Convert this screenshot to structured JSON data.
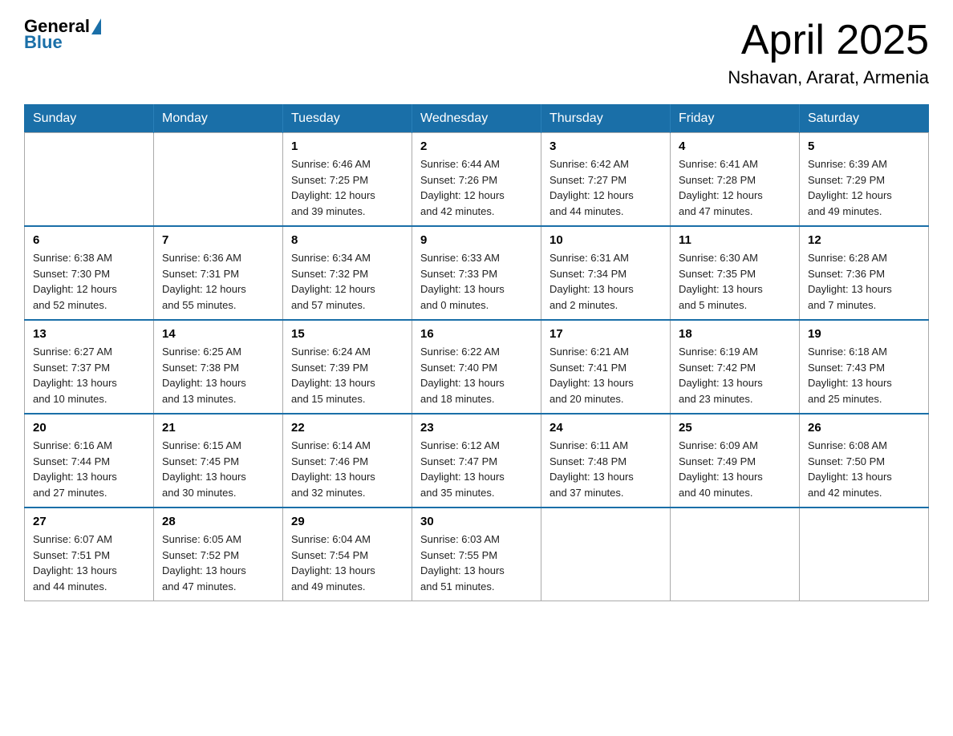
{
  "logo": {
    "general": "General",
    "blue": "Blue"
  },
  "header": {
    "title": "April 2025",
    "location": "Nshavan, Ararat, Armenia"
  },
  "weekdays": [
    "Sunday",
    "Monday",
    "Tuesday",
    "Wednesday",
    "Thursday",
    "Friday",
    "Saturday"
  ],
  "weeks": [
    [
      {
        "day": "",
        "info": ""
      },
      {
        "day": "",
        "info": ""
      },
      {
        "day": "1",
        "info": "Sunrise: 6:46 AM\nSunset: 7:25 PM\nDaylight: 12 hours\nand 39 minutes."
      },
      {
        "day": "2",
        "info": "Sunrise: 6:44 AM\nSunset: 7:26 PM\nDaylight: 12 hours\nand 42 minutes."
      },
      {
        "day": "3",
        "info": "Sunrise: 6:42 AM\nSunset: 7:27 PM\nDaylight: 12 hours\nand 44 minutes."
      },
      {
        "day": "4",
        "info": "Sunrise: 6:41 AM\nSunset: 7:28 PM\nDaylight: 12 hours\nand 47 minutes."
      },
      {
        "day": "5",
        "info": "Sunrise: 6:39 AM\nSunset: 7:29 PM\nDaylight: 12 hours\nand 49 minutes."
      }
    ],
    [
      {
        "day": "6",
        "info": "Sunrise: 6:38 AM\nSunset: 7:30 PM\nDaylight: 12 hours\nand 52 minutes."
      },
      {
        "day": "7",
        "info": "Sunrise: 6:36 AM\nSunset: 7:31 PM\nDaylight: 12 hours\nand 55 minutes."
      },
      {
        "day": "8",
        "info": "Sunrise: 6:34 AM\nSunset: 7:32 PM\nDaylight: 12 hours\nand 57 minutes."
      },
      {
        "day": "9",
        "info": "Sunrise: 6:33 AM\nSunset: 7:33 PM\nDaylight: 13 hours\nand 0 minutes."
      },
      {
        "day": "10",
        "info": "Sunrise: 6:31 AM\nSunset: 7:34 PM\nDaylight: 13 hours\nand 2 minutes."
      },
      {
        "day": "11",
        "info": "Sunrise: 6:30 AM\nSunset: 7:35 PM\nDaylight: 13 hours\nand 5 minutes."
      },
      {
        "day": "12",
        "info": "Sunrise: 6:28 AM\nSunset: 7:36 PM\nDaylight: 13 hours\nand 7 minutes."
      }
    ],
    [
      {
        "day": "13",
        "info": "Sunrise: 6:27 AM\nSunset: 7:37 PM\nDaylight: 13 hours\nand 10 minutes."
      },
      {
        "day": "14",
        "info": "Sunrise: 6:25 AM\nSunset: 7:38 PM\nDaylight: 13 hours\nand 13 minutes."
      },
      {
        "day": "15",
        "info": "Sunrise: 6:24 AM\nSunset: 7:39 PM\nDaylight: 13 hours\nand 15 minutes."
      },
      {
        "day": "16",
        "info": "Sunrise: 6:22 AM\nSunset: 7:40 PM\nDaylight: 13 hours\nand 18 minutes."
      },
      {
        "day": "17",
        "info": "Sunrise: 6:21 AM\nSunset: 7:41 PM\nDaylight: 13 hours\nand 20 minutes."
      },
      {
        "day": "18",
        "info": "Sunrise: 6:19 AM\nSunset: 7:42 PM\nDaylight: 13 hours\nand 23 minutes."
      },
      {
        "day": "19",
        "info": "Sunrise: 6:18 AM\nSunset: 7:43 PM\nDaylight: 13 hours\nand 25 minutes."
      }
    ],
    [
      {
        "day": "20",
        "info": "Sunrise: 6:16 AM\nSunset: 7:44 PM\nDaylight: 13 hours\nand 27 minutes."
      },
      {
        "day": "21",
        "info": "Sunrise: 6:15 AM\nSunset: 7:45 PM\nDaylight: 13 hours\nand 30 minutes."
      },
      {
        "day": "22",
        "info": "Sunrise: 6:14 AM\nSunset: 7:46 PM\nDaylight: 13 hours\nand 32 minutes."
      },
      {
        "day": "23",
        "info": "Sunrise: 6:12 AM\nSunset: 7:47 PM\nDaylight: 13 hours\nand 35 minutes."
      },
      {
        "day": "24",
        "info": "Sunrise: 6:11 AM\nSunset: 7:48 PM\nDaylight: 13 hours\nand 37 minutes."
      },
      {
        "day": "25",
        "info": "Sunrise: 6:09 AM\nSunset: 7:49 PM\nDaylight: 13 hours\nand 40 minutes."
      },
      {
        "day": "26",
        "info": "Sunrise: 6:08 AM\nSunset: 7:50 PM\nDaylight: 13 hours\nand 42 minutes."
      }
    ],
    [
      {
        "day": "27",
        "info": "Sunrise: 6:07 AM\nSunset: 7:51 PM\nDaylight: 13 hours\nand 44 minutes."
      },
      {
        "day": "28",
        "info": "Sunrise: 6:05 AM\nSunset: 7:52 PM\nDaylight: 13 hours\nand 47 minutes."
      },
      {
        "day": "29",
        "info": "Sunrise: 6:04 AM\nSunset: 7:54 PM\nDaylight: 13 hours\nand 49 minutes."
      },
      {
        "day": "30",
        "info": "Sunrise: 6:03 AM\nSunset: 7:55 PM\nDaylight: 13 hours\nand 51 minutes."
      },
      {
        "day": "",
        "info": ""
      },
      {
        "day": "",
        "info": ""
      },
      {
        "day": "",
        "info": ""
      }
    ]
  ]
}
